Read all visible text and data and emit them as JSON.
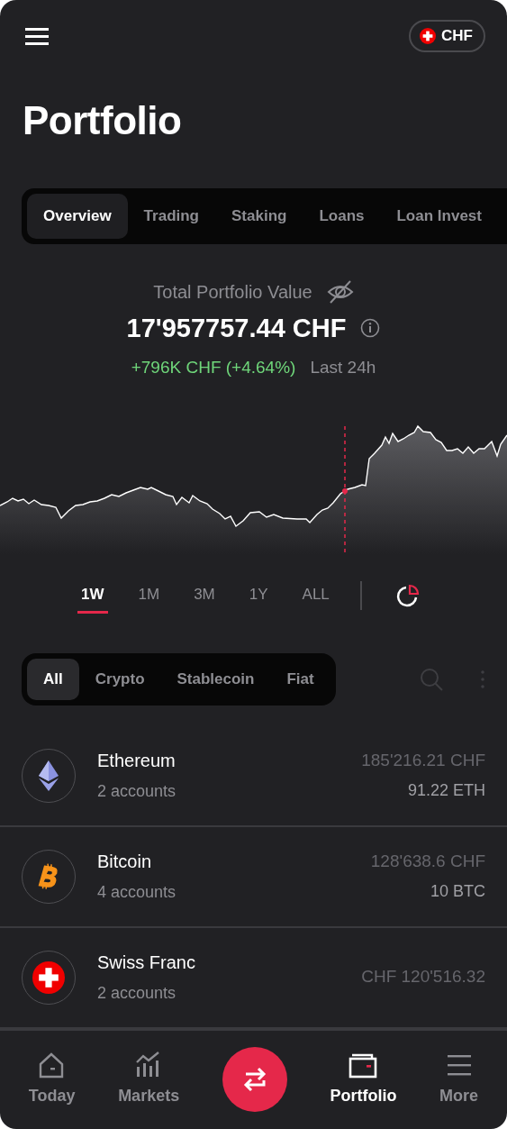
{
  "header": {
    "currency": "CHF"
  },
  "title": "Portfolio",
  "tabs": [
    {
      "label": "Overview",
      "selected": true
    },
    {
      "label": "Trading",
      "selected": false
    },
    {
      "label": "Staking",
      "selected": false
    },
    {
      "label": "Loans",
      "selected": false
    },
    {
      "label": "Loan Invest",
      "selected": false
    }
  ],
  "summary": {
    "label": "Total Portfolio Value",
    "value": "17'957757.44 CHF",
    "change": "+796K CHF (+4.64%)",
    "period": "Last 24h"
  },
  "ranges": [
    {
      "label": "1W",
      "selected": true
    },
    {
      "label": "1M",
      "selected": false
    },
    {
      "label": "3M",
      "selected": false
    },
    {
      "label": "1Y",
      "selected": false
    },
    {
      "label": "ALL",
      "selected": false
    }
  ],
  "filters": [
    {
      "label": "All",
      "selected": true
    },
    {
      "label": "Crypto",
      "selected": false
    },
    {
      "label": "Stablecoin",
      "selected": false
    },
    {
      "label": "Fiat",
      "selected": false
    }
  ],
  "assets": [
    {
      "name": "Ethereum",
      "accounts": "2 accounts",
      "value": "185'216.21 CHF",
      "amount": "91.22 ETH"
    },
    {
      "name": "Bitcoin",
      "accounts": "4 accounts",
      "value": "128'638.6 CHF",
      "amount": "10 BTC"
    },
    {
      "name": "Swiss Franc",
      "accounts": "2 accounts",
      "value": "CHF 120'516.32"
    }
  ],
  "nav": [
    {
      "kind": "tab",
      "label": "Today",
      "selected": false
    },
    {
      "kind": "tab",
      "label": "Markets",
      "selected": false
    },
    {
      "kind": "action"
    },
    {
      "kind": "tab",
      "label": "Portfolio",
      "selected": true
    },
    {
      "kind": "tab",
      "label": "More",
      "selected": false
    }
  ]
}
